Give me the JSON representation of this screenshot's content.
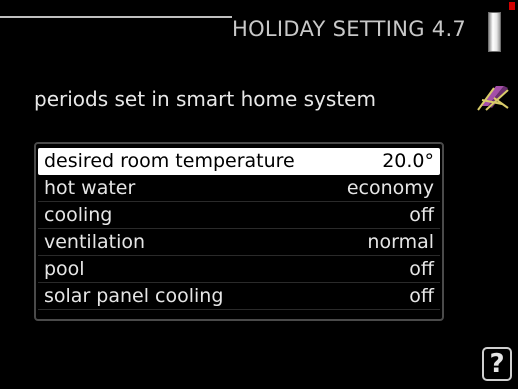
{
  "header": {
    "title": "HOLIDAY SETTING 4.7"
  },
  "subtitle": "periods set in smart home system",
  "settings": [
    {
      "label": "desired room temperature",
      "value": "20.0°"
    },
    {
      "label": "hot water",
      "value": "economy"
    },
    {
      "label": "cooling",
      "value": "off"
    },
    {
      "label": "ventilation",
      "value": "normal"
    },
    {
      "label": "pool",
      "value": "off"
    },
    {
      "label": "solar panel cooling",
      "value": "off"
    }
  ],
  "help": {
    "label": "?"
  },
  "colors": {
    "accent": "#d00000",
    "selection": "#ffffff",
    "background": "#000000"
  },
  "icons": {
    "status": "thermometer-icon",
    "mode": "deck-chair-icon",
    "help": "help-icon"
  }
}
